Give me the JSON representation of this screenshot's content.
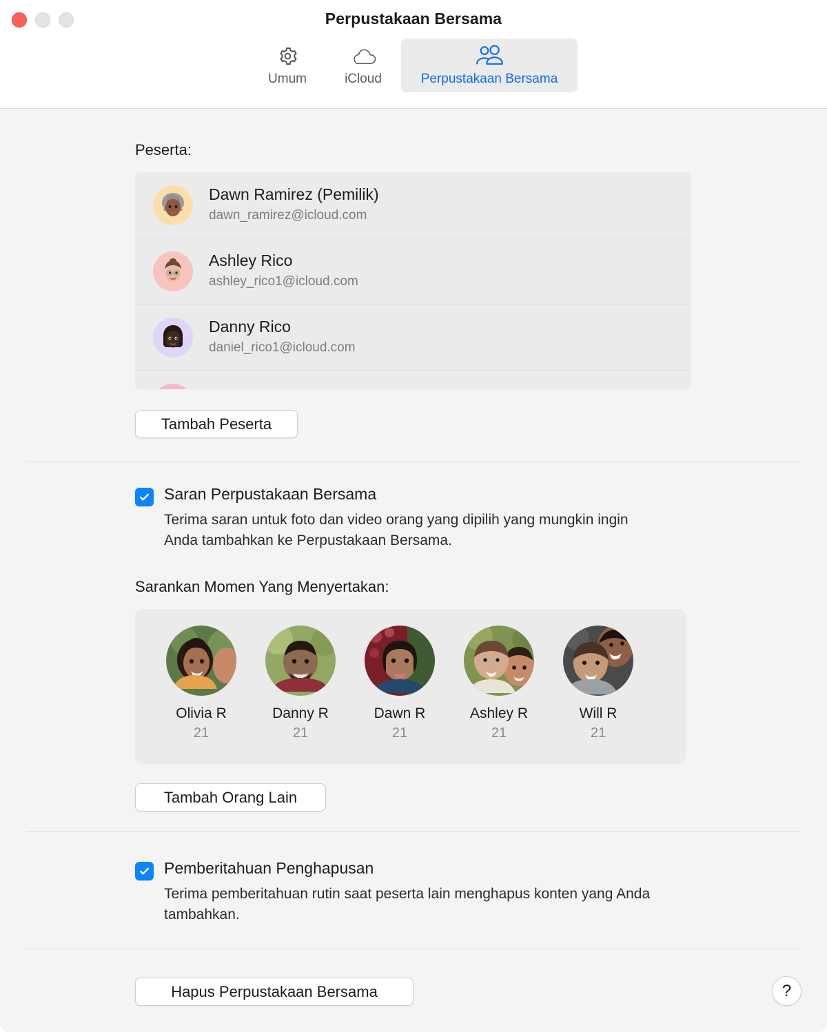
{
  "window": {
    "title": "Perpustakaan Bersama",
    "traffic_lights": [
      "close",
      "minimize",
      "maximize"
    ],
    "accent_blue": "#0a6cf5",
    "checkbox_blue": "#0a84ff",
    "content_bg": "#f4f4f4",
    "list_bg": "#ebebeb"
  },
  "toolbar": {
    "tabs": [
      {
        "label": "Umum",
        "icon": "gear-icon",
        "active": false
      },
      {
        "label": "iCloud",
        "icon": "cloud-icon",
        "active": false
      },
      {
        "label": "Perpustakaan Bersama",
        "icon": "people-group-icon",
        "active": true
      }
    ]
  },
  "participants_section": {
    "label": "Peserta:",
    "rows": [
      {
        "name": "Dawn Ramirez (Pemilik)",
        "email": "dawn_ramirez@icloud.com",
        "avatar": "memoji-dawn",
        "bg": "#fbdfab",
        "skin": "#8d5a3f",
        "hair": "#8e8e93"
      },
      {
        "name": "Ashley Rico",
        "email": "ashley_rico1@icloud.com",
        "avatar": "memoji-ashley",
        "bg": "#f9c4c0",
        "skin": "#e8bda2",
        "hair": "#6f4a30"
      },
      {
        "name": "Danny Rico",
        "email": "daniel_rico1@icloud.com",
        "avatar": "memoji-danny",
        "bg": "#ddd6f6",
        "skin": "#3f2a20",
        "hair": "#241812"
      },
      {
        "name": "",
        "email": "",
        "avatar": "memoji-partial",
        "bg": "#f7b8cc",
        "skin": "#7a3550",
        "hair": "#7a3550"
      }
    ],
    "add_button": "Tambah Peserta"
  },
  "suggestions_section": {
    "checkbox": {
      "checked": true,
      "title": "Saran Perpustakaan Bersama",
      "description": "Terima saran untuk foto dan video orang yang dipilih yang mungkin ingin Anda tambahkan ke Perpustakaan Bersama."
    },
    "people_label": "Sarankan Momen Yang Menyertakan:",
    "people": [
      {
        "name": "Olivia R",
        "count": "21",
        "photo": "portrait-olivia",
        "c1": "#4b6b3a",
        "c2": "#8c5a42",
        "c3": "#d9a98b"
      },
      {
        "name": "Danny R",
        "count": "21",
        "photo": "portrait-danny",
        "c1": "#7d8f4e",
        "c2": "#4a3226",
        "c3": "#8e6a52"
      },
      {
        "name": "Dawn R",
        "count": "21",
        "photo": "portrait-dawn",
        "c1": "#7a1e28",
        "c2": "#3a2418",
        "c3": "#a97a5e"
      },
      {
        "name": "Ashley R",
        "count": "21",
        "photo": "portrait-ashley",
        "c1": "#6b7f46",
        "c2": "#6b4a34",
        "c3": "#d6ab8c"
      },
      {
        "name": "Will R",
        "count": "21",
        "photo": "portrait-will",
        "c1": "#3a3a3a",
        "c2": "#5a3a2a",
        "c3": "#c49a78"
      }
    ],
    "add_button": "Tambah Orang Lain"
  },
  "deletion_section": {
    "checkbox": {
      "checked": true,
      "title": "Pemberitahuan Penghapusan",
      "description": "Terima pemberitahuan rutin saat peserta lain menghapus konten yang Anda tambahkan."
    }
  },
  "footer": {
    "delete_button": "Hapus Perpustakaan Bersama",
    "help_label": "?"
  }
}
